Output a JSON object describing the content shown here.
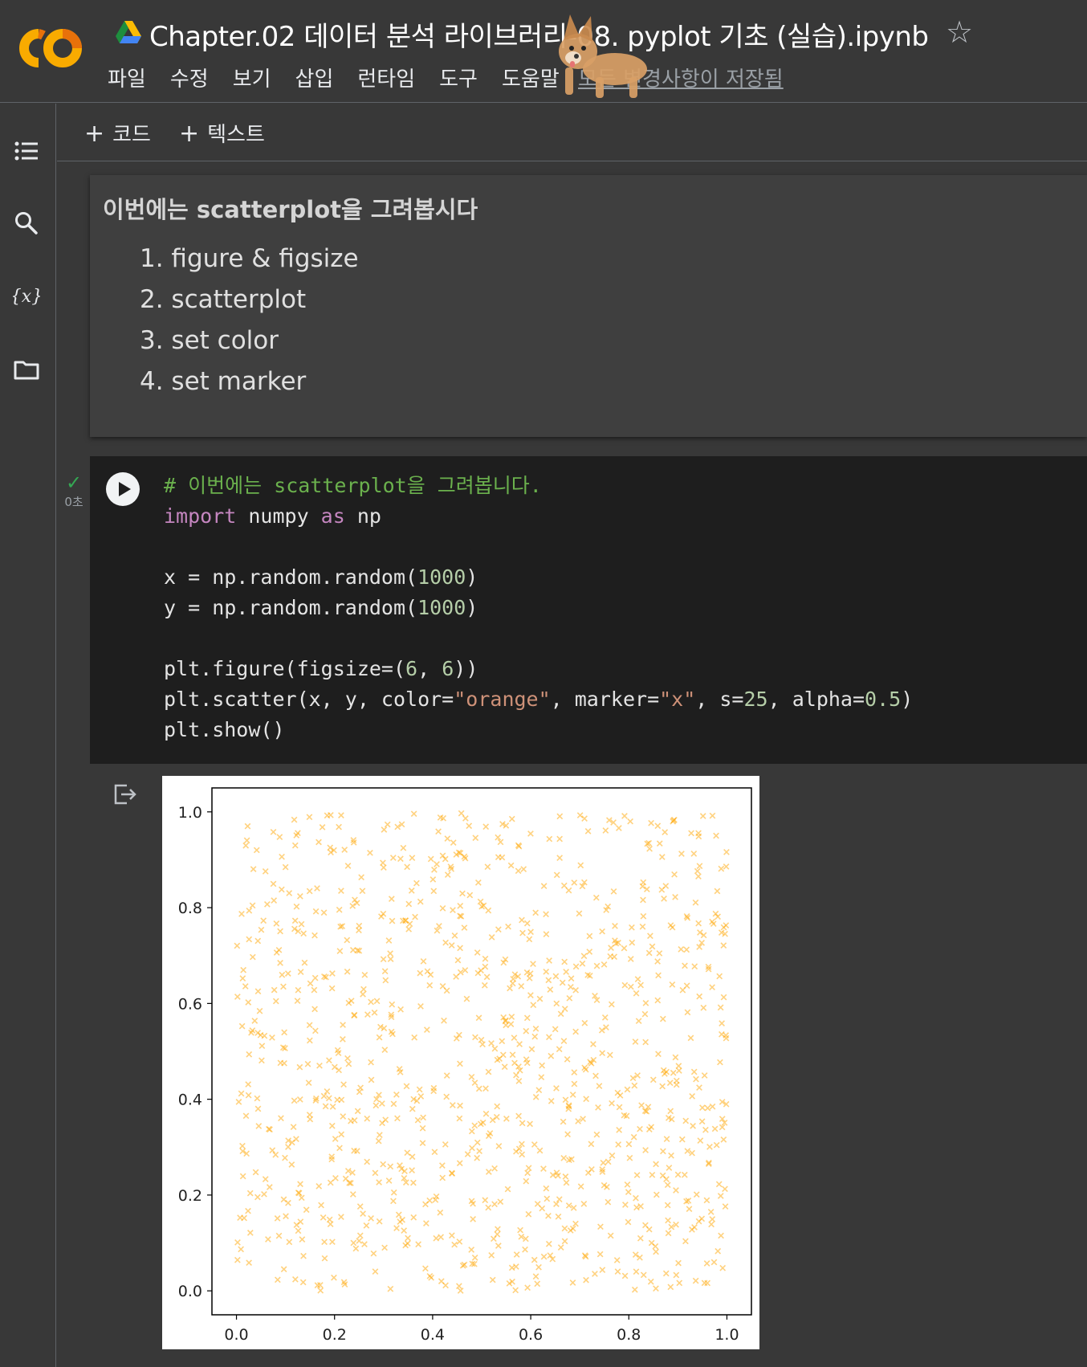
{
  "app": {
    "notebook_title": "Chapter.02 데이터 분석 라이브러리-08. pyplot 기초 (실습).ipynb",
    "menu": [
      "파일",
      "수정",
      "보기",
      "삽입",
      "런타임",
      "도구",
      "도움말"
    ],
    "save_status": "모든 변경사항이 저장됨"
  },
  "toolbar": {
    "add_code_label": "코드",
    "add_text_label": "텍스트"
  },
  "icons": {
    "logo": "colab-logo",
    "drive": "google-drive-icon",
    "star": "star-outline-icon",
    "rail": [
      "table-of-contents-icon",
      "search-icon",
      "variables-icon",
      "folder-icon"
    ],
    "run": "play-icon",
    "output": "output-redirect-icon",
    "mascot": "corgi-mascot"
  },
  "text_cell": {
    "heading": "이번에는 scatterplot을 그려봅시다",
    "items": [
      "1. figure & figsize",
      "2. scatterplot",
      "3. set color",
      "4. set marker"
    ]
  },
  "code_cell": {
    "status": "✓",
    "exec_time": "0초",
    "lines": [
      [
        {
          "t": "# 이번에는 scatterplot을 그려봅니다.",
          "c": "comment"
        }
      ],
      [
        {
          "t": "import",
          "c": "kw"
        },
        {
          "t": " numpy ",
          "c": ""
        },
        {
          "t": "as",
          "c": "kw"
        },
        {
          "t": " np",
          "c": ""
        }
      ],
      [],
      [
        {
          "t": "x = np.random.random(",
          "c": ""
        },
        {
          "t": "1000",
          "c": "num"
        },
        {
          "t": ")",
          "c": ""
        }
      ],
      [
        {
          "t": "y = np.random.random(",
          "c": ""
        },
        {
          "t": "1000",
          "c": "num"
        },
        {
          "t": ")",
          "c": ""
        }
      ],
      [],
      [
        {
          "t": "plt.figure(figsize=(",
          "c": ""
        },
        {
          "t": "6",
          "c": "num"
        },
        {
          "t": ", ",
          "c": ""
        },
        {
          "t": "6",
          "c": "num"
        },
        {
          "t": "))",
          "c": ""
        }
      ],
      [
        {
          "t": "plt.scatter(x, y, color=",
          "c": ""
        },
        {
          "t": "\"orange\"",
          "c": "str"
        },
        {
          "t": ", marker=",
          "c": ""
        },
        {
          "t": "\"x\"",
          "c": "str"
        },
        {
          "t": ", s=",
          "c": ""
        },
        {
          "t": "25",
          "c": "num"
        },
        {
          "t": ", alpha=",
          "c": ""
        },
        {
          "t": "0.5",
          "c": "num"
        },
        {
          "t": ")",
          "c": ""
        }
      ],
      [
        {
          "t": "plt.show()",
          "c": ""
        }
      ]
    ]
  },
  "chart_data": {
    "type": "scatter",
    "title": "",
    "xlabel": "",
    "ylabel": "",
    "xlim": [
      -0.05,
      1.05
    ],
    "ylim": [
      -0.05,
      1.05
    ],
    "xticks": [
      "0.0",
      "0.2",
      "0.4",
      "0.6",
      "0.8",
      "1.0"
    ],
    "yticks": [
      "0.0",
      "0.2",
      "0.4",
      "0.6",
      "0.8",
      "1.0"
    ],
    "grid": false,
    "legend": "none",
    "marker": "x",
    "marker_size": 25,
    "color": "#ffa500",
    "alpha": 0.5,
    "n_points": 1000,
    "distribution": "uniform random on [0, 1] for both x and y"
  }
}
